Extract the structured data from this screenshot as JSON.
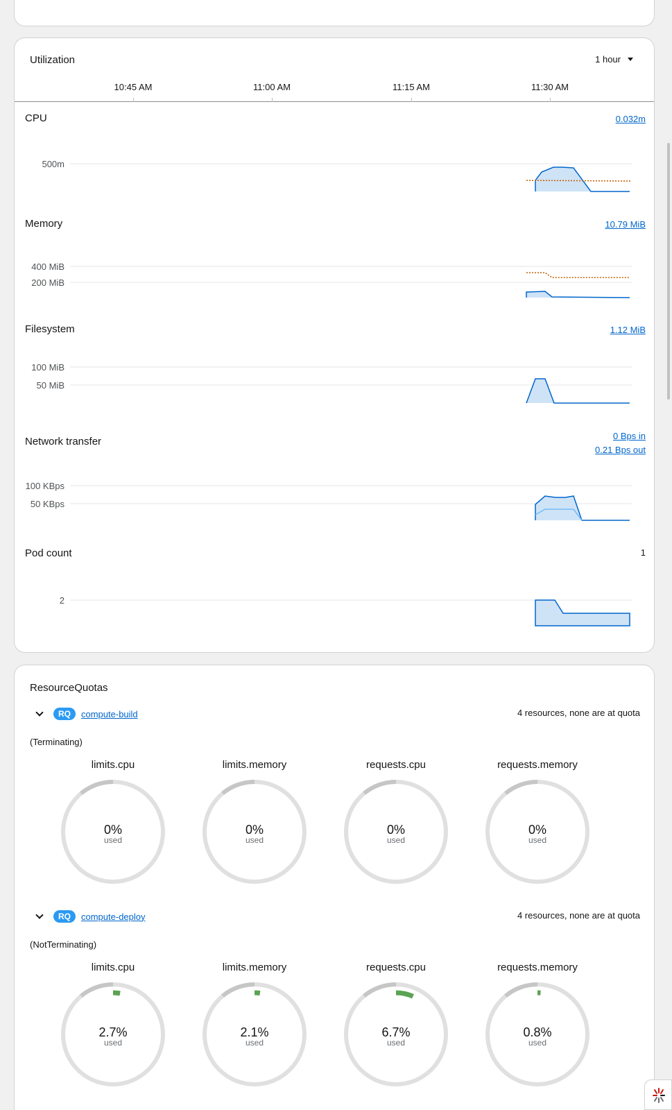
{
  "utilization": {
    "title": "Utilization",
    "time_range": "1 hour",
    "time_ticks": [
      "10:45 AM",
      "11:00 AM",
      "11:15 AM",
      "11:30 AM"
    ],
    "metrics": [
      {
        "name": "CPU",
        "value": "0.032m",
        "y_ticks": [
          "500m"
        ]
      },
      {
        "name": "Memory",
        "value": "10.79 MiB",
        "y_ticks": [
          "400 MiB",
          "200 MiB"
        ]
      },
      {
        "name": "Filesystem",
        "value": "1.12 MiB",
        "y_ticks": [
          "100 MiB",
          "50 MiB"
        ]
      },
      {
        "name": "Network transfer",
        "value_in": "0 Bps in",
        "value_out": "0.21 Bps out",
        "y_ticks": [
          "100 KBps",
          "50 KBps"
        ]
      },
      {
        "name": "Pod count",
        "value": "1",
        "y_ticks": [
          "2"
        ]
      }
    ]
  },
  "resource_quotas": {
    "title": "ResourceQuotas",
    "badge": "RQ",
    "quotas": [
      {
        "name": "compute-build",
        "summary": "4 resources, none are at quota",
        "scope": "(Terminating)",
        "gauges": [
          {
            "label": "limits.cpu",
            "percent": "0%",
            "fraction": 0,
            "used": "used"
          },
          {
            "label": "limits.memory",
            "percent": "0%",
            "fraction": 0,
            "used": "used"
          },
          {
            "label": "requests.cpu",
            "percent": "0%",
            "fraction": 0,
            "used": "used"
          },
          {
            "label": "requests.memory",
            "percent": "0%",
            "fraction": 0,
            "used": "used"
          }
        ]
      },
      {
        "name": "compute-deploy",
        "summary": "4 resources, none are at quota",
        "scope": "(NotTerminating)",
        "gauges": [
          {
            "label": "limits.cpu",
            "percent": "2.7%",
            "fraction": 0.027,
            "used": "used"
          },
          {
            "label": "limits.memory",
            "percent": "2.1%",
            "fraction": 0.021,
            "used": "used"
          },
          {
            "label": "requests.cpu",
            "percent": "6.7%",
            "fraction": 0.067,
            "used": "used"
          },
          {
            "label": "requests.memory",
            "percent": "0.8%",
            "fraction": 0.008,
            "used": "used"
          }
        ]
      }
    ]
  },
  "colors": {
    "usage_line": "#0066cc",
    "usage_fill": "#cfe3f7",
    "limit_line": "#c46100",
    "gauge_track": "#e0e0e0",
    "gauge_threshold": "#c6c6c6",
    "gauge_fill": "#5ba352",
    "link": "#0066cc"
  }
}
